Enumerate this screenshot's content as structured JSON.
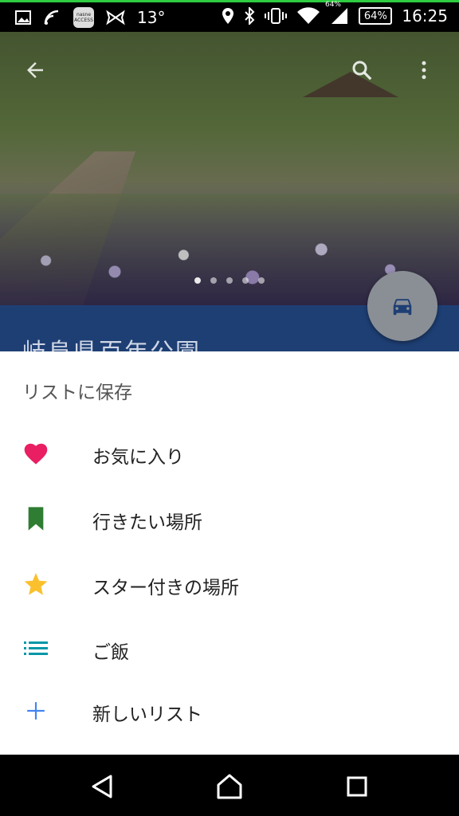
{
  "status_bar": {
    "temperature": "13°",
    "battery_small": "64%",
    "battery": "64%",
    "time": "16:25",
    "app_badge": "nasne ACCESS"
  },
  "hero": {
    "icons": {
      "back": "arrow-back-icon",
      "search": "search-icon",
      "more": "more-vert-icon"
    }
  },
  "place": {
    "title": "岐阜県百年公園"
  },
  "save_sheet": {
    "title": "リストに保存",
    "items": [
      {
        "label": "お気に入り",
        "icon": "heart-icon",
        "color": "#e91e63"
      },
      {
        "label": "行きたい場所",
        "icon": "bookmark-icon",
        "color": "#2e7d32"
      },
      {
        "label": "スター付きの場所",
        "icon": "star-icon",
        "color": "#fbc02d"
      },
      {
        "label": "ご飯",
        "icon": "list-icon",
        "color": "#0097a7"
      },
      {
        "label": "新しいリスト",
        "icon": "plus-icon",
        "color": "#4285f4"
      }
    ]
  },
  "colors": {
    "title_band": "#1e3f74",
    "fab": "#8a8f96",
    "fab_icon": "#1e3f74"
  }
}
